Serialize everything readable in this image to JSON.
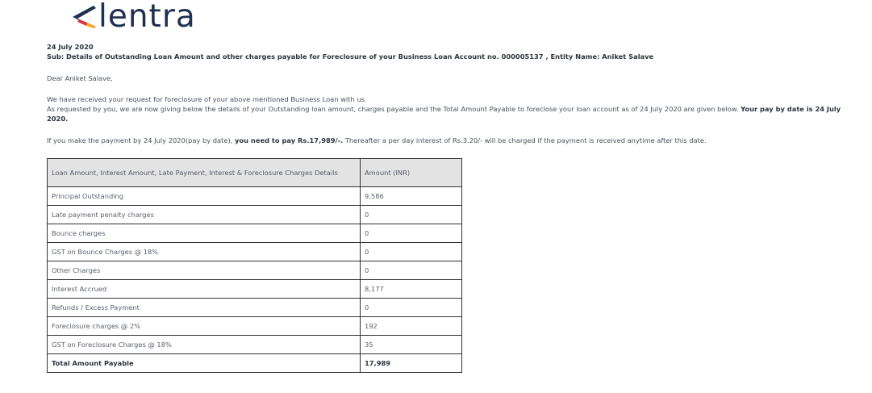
{
  "brand": {
    "name": "lentra",
    "mark_colors": {
      "navy": "#1f3050",
      "red": "#d9333f",
      "orange": "#f5a623"
    }
  },
  "letter": {
    "date": "24 July 2020",
    "subject": "Sub: Details of Outstanding Loan Amount and other charges payable for Foreclosure of your Business Loan Account no. 000005137 , Entity Name: Aniket Salave",
    "salutation": "Dear Aniket Salave,",
    "para1": "We have received your request for foreclosure of your above mentioned Business Loan with us.",
    "para2": "As requested by you, we are now giving below the details of your Outstanding loan amount, charges payable and the Total Amount Payable to foreclose your loan account as of 24 July 2020 are given below. ",
    "para2_bold": "Your pay by date is 24 July 2020.",
    "para3_pre": "If you make the payment by 24 July 2020(pay by date), ",
    "para3_bold": "you need to pay Rs.17,989/-.",
    "para3_post": " Thereafter a per day interest of Rs.3.20/- will be charged if the payment is received anytime after this date."
  },
  "table": {
    "headers": [
      "Loan Amount, Interest Amount, Late Payment, Interest & Foreclosure Charges Details",
      "Amount (INR)"
    ],
    "rows": [
      {
        "label": "Principal Outstanding",
        "amount": "9,586"
      },
      {
        "label": "Late payment penalty charges",
        "amount": "0"
      },
      {
        "label": "Bounce charges",
        "amount": "0"
      },
      {
        "label": "GST on Bounce Charges @ 18%",
        "amount": "0"
      },
      {
        "label": "Other Charges",
        "amount": "0"
      },
      {
        "label": "Interest Accrued",
        "amount": "8,177"
      },
      {
        "label": "Refunds / Excess Payment",
        "amount": "0"
      },
      {
        "label": "Foreclosure charges @ 2%",
        "amount": "192"
      },
      {
        "label": "GST on Foreclosure Charges @ 18%",
        "amount": "35"
      }
    ],
    "total": {
      "label": "Total Amount Payable",
      "amount": "17,989"
    }
  }
}
